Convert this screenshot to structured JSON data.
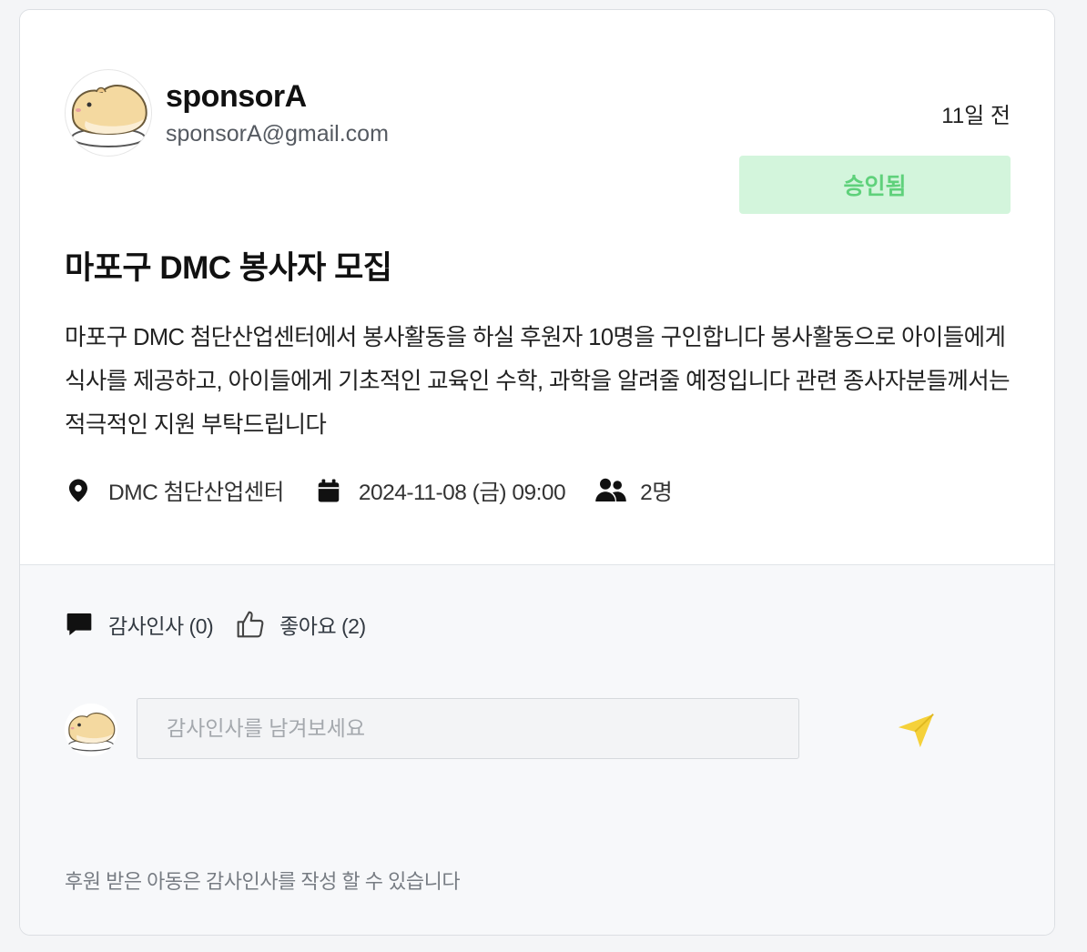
{
  "post": {
    "author": {
      "name": "sponsorA",
      "email": "sponsorA@gmail.com",
      "avatar_icon": "hamster-avatar-icon"
    },
    "time_ago": "11일 전",
    "status": {
      "label": "승인됨",
      "bg_color": "#d3f5dc",
      "text_color": "#5fd17b"
    },
    "title": "마포구 DMC 봉사자 모집",
    "body": "마포구 DMC 첨단산업센터에서 봉사활동을 하실 후원자 10명을 구인합니다 봉사활동으로 아이들에게 식사를 제공하고, 아이들에게 기초적인 교육인 수학, 과학을 알려줄 예정입니다 관련 종사자분들께서는 적극적인 지원 부탁드립니다",
    "meta": {
      "location": "DMC 첨단산업센터",
      "location_icon": "map-pin-icon",
      "datetime": "2024-11-08 (금) 09:00",
      "datetime_icon": "calendar-icon",
      "participants": "2명",
      "participants_icon": "users-icon"
    }
  },
  "actions": {
    "thanks_label": "감사인사 (0)",
    "thanks_icon": "comment-icon",
    "like_label": "좋아요 (2)",
    "like_icon": "thumbs-up-icon"
  },
  "comment": {
    "placeholder": "감사인사를 남겨보세요",
    "send_icon": "send-icon",
    "send_color": "#f5d13a"
  },
  "notice": "후원 받은 아동은 감사인사를 작성 할 수 있습니다"
}
